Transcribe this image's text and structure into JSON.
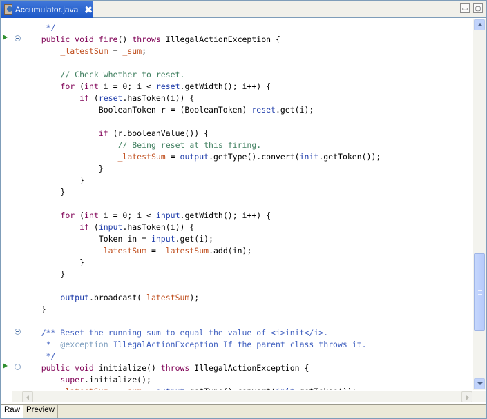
{
  "tab": {
    "title": "Accumulator.java",
    "close": "✖"
  },
  "window_buttons": {
    "minimize": "▭",
    "maximize": "▢"
  },
  "code_lines": [
    [
      [
        "jdoc",
        "     */"
      ]
    ],
    [
      [
        "kw",
        "    public void "
      ],
      [
        "fn",
        "fire"
      ],
      [
        "plain",
        "() "
      ],
      [
        "kw",
        "throws "
      ],
      [
        "plain",
        "IllegalActionException {"
      ]
    ],
    [
      [
        "plain",
        "        "
      ],
      [
        "field",
        "_latestSum"
      ],
      [
        "plain",
        " = "
      ],
      [
        "field",
        "_sum"
      ],
      [
        "plain",
        ";"
      ]
    ],
    [
      [
        "plain",
        ""
      ]
    ],
    [
      [
        "plain",
        "        "
      ],
      [
        "cmt",
        "// Check whether to reset."
      ]
    ],
    [
      [
        "plain",
        "        "
      ],
      [
        "kw",
        "for "
      ],
      [
        "plain",
        "("
      ],
      [
        "kw",
        "int "
      ],
      [
        "plain",
        "i = 0; i < "
      ],
      [
        "var",
        "reset"
      ],
      [
        "plain",
        ".getWidth(); i++) {"
      ]
    ],
    [
      [
        "plain",
        "            "
      ],
      [
        "kw",
        "if "
      ],
      [
        "plain",
        "("
      ],
      [
        "var",
        "reset"
      ],
      [
        "plain",
        ".hasToken(i)) {"
      ]
    ],
    [
      [
        "plain",
        "                BooleanToken r = (BooleanToken) "
      ],
      [
        "var",
        "reset"
      ],
      [
        "plain",
        ".get(i);"
      ]
    ],
    [
      [
        "plain",
        ""
      ]
    ],
    [
      [
        "plain",
        "                "
      ],
      [
        "kw",
        "if "
      ],
      [
        "plain",
        "(r.booleanValue()) {"
      ]
    ],
    [
      [
        "plain",
        "                    "
      ],
      [
        "cmt",
        "// Being reset at this firing."
      ]
    ],
    [
      [
        "plain",
        "                    "
      ],
      [
        "field",
        "_latestSum"
      ],
      [
        "plain",
        " = "
      ],
      [
        "var",
        "output"
      ],
      [
        "plain",
        ".getType().convert("
      ],
      [
        "var",
        "init"
      ],
      [
        "plain",
        ".getToken());"
      ]
    ],
    [
      [
        "plain",
        "                }"
      ]
    ],
    [
      [
        "plain",
        "            }"
      ]
    ],
    [
      [
        "plain",
        "        }"
      ]
    ],
    [
      [
        "plain",
        ""
      ]
    ],
    [
      [
        "plain",
        "        "
      ],
      [
        "kw",
        "for "
      ],
      [
        "plain",
        "("
      ],
      [
        "kw",
        "int "
      ],
      [
        "plain",
        "i = 0; i < "
      ],
      [
        "var",
        "input"
      ],
      [
        "plain",
        ".getWidth(); i++) {"
      ]
    ],
    [
      [
        "plain",
        "            "
      ],
      [
        "kw",
        "if "
      ],
      [
        "plain",
        "("
      ],
      [
        "var",
        "input"
      ],
      [
        "plain",
        ".hasToken(i)) {"
      ]
    ],
    [
      [
        "plain",
        "                Token in = "
      ],
      [
        "var",
        "input"
      ],
      [
        "plain",
        ".get(i);"
      ]
    ],
    [
      [
        "plain",
        "                "
      ],
      [
        "field",
        "_latestSum"
      ],
      [
        "plain",
        " = "
      ],
      [
        "field",
        "_latestSum"
      ],
      [
        "plain",
        ".add(in);"
      ]
    ],
    [
      [
        "plain",
        "            }"
      ]
    ],
    [
      [
        "plain",
        "        }"
      ]
    ],
    [
      [
        "plain",
        ""
      ]
    ],
    [
      [
        "plain",
        "        "
      ],
      [
        "var",
        "output"
      ],
      [
        "plain",
        ".broadcast("
      ],
      [
        "field",
        "_latestSum"
      ],
      [
        "plain",
        ");"
      ]
    ],
    [
      [
        "plain",
        "    }"
      ]
    ],
    [
      [
        "plain",
        ""
      ]
    ],
    [
      [
        "jdoc",
        "    /** Reset the running sum to equal the value of <i>init</i>."
      ]
    ],
    [
      [
        "jdoc",
        "     *  "
      ],
      [
        "jdoc-tag",
        "@exception"
      ],
      [
        "jdoc",
        " IllegalActionException If the parent class throws it."
      ]
    ],
    [
      [
        "jdoc",
        "     */"
      ]
    ],
    [
      [
        "kw",
        "    public void "
      ],
      [
        "plain",
        "initialize() "
      ],
      [
        "kw",
        "throws "
      ],
      [
        "plain",
        "IllegalActionException {"
      ]
    ],
    [
      [
        "plain",
        "        "
      ],
      [
        "kw",
        "super"
      ],
      [
        "plain",
        ".initialize();"
      ]
    ],
    [
      [
        "plain",
        "        "
      ],
      [
        "field",
        "_latestSum"
      ],
      [
        "plain",
        " = "
      ],
      [
        "field",
        "_sum"
      ],
      [
        "plain",
        " = "
      ],
      [
        "var",
        "output"
      ],
      [
        "plain",
        ".getType().convert("
      ],
      [
        "var",
        "init"
      ],
      [
        "plain",
        ".getToken());"
      ]
    ]
  ],
  "bottom_tabs": [
    {
      "label": "Raw",
      "active": true
    },
    {
      "label": "Preview",
      "active": false
    }
  ]
}
